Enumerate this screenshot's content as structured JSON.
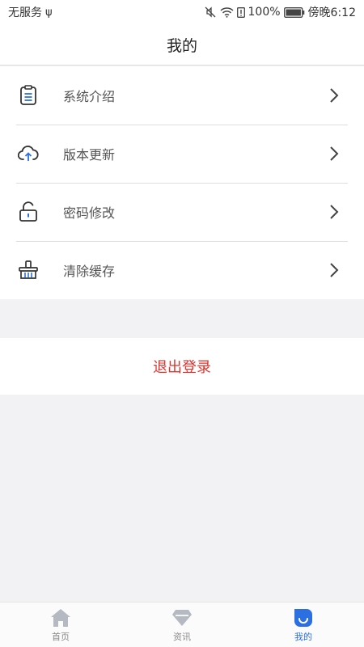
{
  "status_bar": {
    "carrier": "无服务",
    "usb_symbol": "ψ",
    "battery": "100%",
    "time": "傍晚6:12"
  },
  "header": {
    "title": "我的"
  },
  "menu": {
    "items": [
      {
        "label": "系统介绍",
        "icon": "document-icon"
      },
      {
        "label": "版本更新",
        "icon": "cloud-upload-icon"
      },
      {
        "label": "密码修改",
        "icon": "lock-icon"
      },
      {
        "label": "清除缓存",
        "icon": "basket-icon"
      }
    ]
  },
  "logout": {
    "label": "退出登录",
    "color": "#e0342f"
  },
  "tabbar": {
    "active_color": "#2b6fe3",
    "inactive_color": "#b5b9c2",
    "tabs": [
      {
        "label": "首页",
        "icon": "home-icon",
        "active": false
      },
      {
        "label": "资讯",
        "icon": "diamond-icon",
        "active": false
      },
      {
        "label": "我的",
        "icon": "smile-icon",
        "active": true
      }
    ]
  }
}
